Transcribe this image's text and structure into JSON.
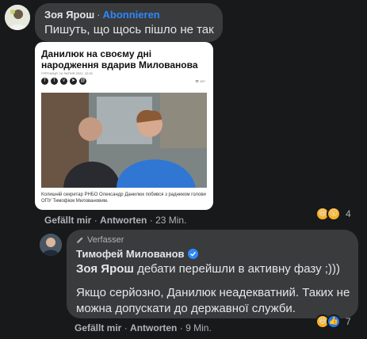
{
  "comment1": {
    "author": "Зоя Ярош",
    "separator": "·",
    "follow_label": "Abonnieren",
    "text": "Пишуть, що щось пішло не так",
    "image": {
      "headline": "Данилюк на своєму дні народження вдарив Милованова",
      "date": "П'ЯТНИЦЯ, 16 ЛИПНЯ 2021, 22:26",
      "views": "👁 457",
      "caption": "Колишній секретар РНБО Олександр Данилюк побився з радником голови ОПУ Тимофієм Миловановим."
    },
    "like_label": "Gefällt mir",
    "dot": "·",
    "reply_label": "Antworten",
    "time": "23 Min.",
    "reaction_count": "4"
  },
  "comment2": {
    "badge": "Verfasser",
    "author": "Тимофей Милованов",
    "mention": "Зоя Ярош",
    "line1_rest": "дебати перейшли в активну фазу ;)))",
    "paragraph": "Якщо серйозно, Данилюк неадекватний. Таких не можна допускати до державної служби.",
    "like_label": "Gefällt mir",
    "dot": "·",
    "reply_label": "Antworten",
    "time": "9 Min.",
    "reaction_count": "7"
  },
  "colors": {
    "background": "#18191a",
    "bubble": "#3a3b3c",
    "link": "#2d88ff",
    "text": "#e4e6eb",
    "meta": "#b0b3b8"
  }
}
